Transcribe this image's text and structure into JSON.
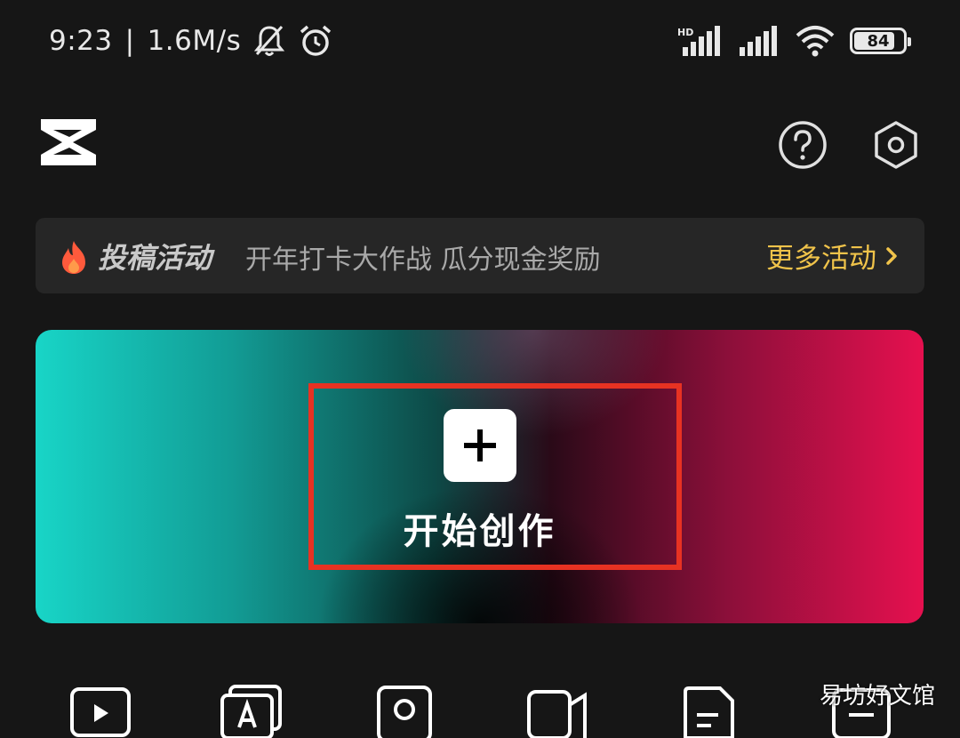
{
  "status_bar": {
    "time": "9:23",
    "network_speed": "1.6M/s",
    "separator": "|",
    "signal_label": "HD",
    "battery_level": "84",
    "battery_fraction": 0.84,
    "icons": [
      "bell-off-icon",
      "alarm-icon",
      "signal-hd-icon",
      "signal-icon",
      "wifi-icon",
      "battery-icon"
    ]
  },
  "header": {
    "logo": "capcut-logo",
    "icons": [
      "help-icon",
      "settings-icon"
    ]
  },
  "activity_banner": {
    "title": "投稿活动",
    "description": "开年打卡大作战 瓜分现金奖励",
    "more_label": "更多活动",
    "icon": "flame-icon",
    "accent_color": "#f0c34a"
  },
  "create_card": {
    "label": "开始创作",
    "icon": "plus-icon",
    "highlight_color": "#e73222",
    "gradient_colors": [
      "#18d5c7",
      "#e6104f"
    ]
  },
  "tools_row": {
    "icons": [
      "video-play-icon",
      "text-template-icon",
      "camera-icon",
      "video-camera-icon",
      "document-icon",
      "subtitle-icon"
    ]
  },
  "watermark": "易坊好文馆"
}
